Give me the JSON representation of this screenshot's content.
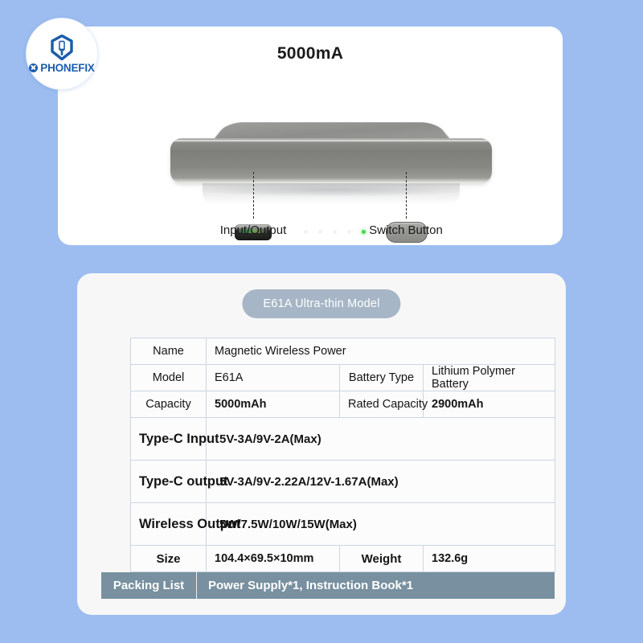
{
  "brand": {
    "name": "PHONEFIX",
    "mark_icon": "shield-phone-wrench-icon",
    "dot_icon": "x-mark-icon"
  },
  "product": {
    "title": "5000mA",
    "callouts": {
      "left": "Input/Output",
      "right": "Switch Button"
    },
    "led_count": 4
  },
  "spec_card": {
    "badge": "E61A Ultra-thin Model",
    "rows": {
      "name": {
        "label": "Name",
        "value": "Magnetic Wireless Power"
      },
      "model": {
        "label": "Model",
        "value": "E61A"
      },
      "battery_type": {
        "label": "Battery Type",
        "value": "Lithium Polymer Battery"
      },
      "capacity": {
        "label": "Capacity",
        "value": "5000mAh"
      },
      "rated_capacity": {
        "label": "Rated Capacity",
        "value": "2900mAh"
      },
      "typec_input": {
        "label": "Type-C Input",
        "value": "5V-3A/9V-2A(Max)"
      },
      "typec_output": {
        "label": "Type-C output",
        "value": "5V-3A/9V-2.22A/12V-1.67A(Max)"
      },
      "wireless_output": {
        "label": "Wireless Output",
        "value": "5W/7.5W/10W/15W(Max)"
      },
      "size": {
        "label": "Size",
        "value": "104.4×69.5×10mm"
      },
      "weight": {
        "label": "Weight",
        "value": "132.6g"
      },
      "packing_list": {
        "label": "Packing List",
        "value": "Power Supply*1, Instruction Book*1"
      }
    }
  },
  "colors": {
    "page_background": "#9dbdf0",
    "card_background": "#ffffff",
    "spec_card_background": "#f7f7f7",
    "brand_blue": "#1b5cab",
    "badge_gray_blue": "#a6b6c6",
    "packing_bar": "#78909f",
    "table_border": "#ccd6e4"
  }
}
